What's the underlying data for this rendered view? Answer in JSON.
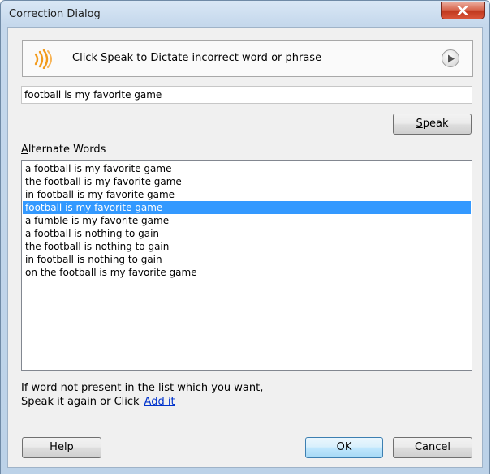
{
  "window": {
    "title": "Correction Dialog"
  },
  "speak_panel": {
    "instruction": "Click Speak to Dictate incorrect word or phrase",
    "icons": [
      "speaker-icon",
      "play-icon"
    ]
  },
  "recognized_text": "football is my favorite game",
  "buttons": {
    "speak_mnemonic": "S",
    "speak_rest": "peak",
    "help": "Help",
    "ok": "OK",
    "cancel": "Cancel"
  },
  "alternates": {
    "label_mnemonic": "A",
    "label_rest": "lternate Words",
    "selected_index": 3,
    "items": [
      "a football is my favorite game",
      "the football is my favorite game",
      "in football is my favorite game",
      "football is my favorite game",
      "a fumble is my favorite game",
      "a football is nothing to gain",
      "the football is nothing to gain",
      "in football is nothing to gain",
      "on the football is my favorite game"
    ]
  },
  "hint": {
    "line1": "If word not present in the list which you want,",
    "line2": "Speak it again or Click",
    "link": "Add it"
  },
  "colors": {
    "selection": "#3399ff",
    "link": "#0033cc",
    "speaker_accent": "#f29a1a",
    "close_button": "#c1391f"
  }
}
